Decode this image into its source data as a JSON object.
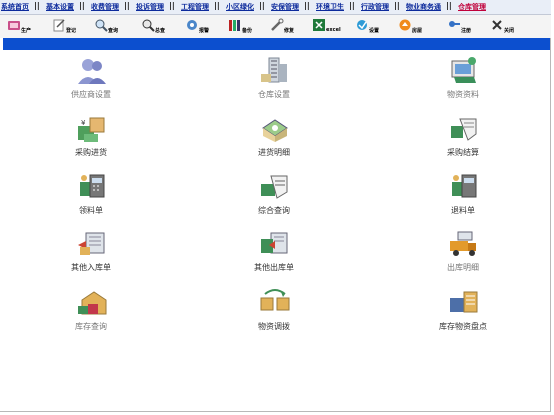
{
  "nav": [
    {
      "label": "系统首页",
      "active": false
    },
    {
      "label": "基本设置",
      "active": false
    },
    {
      "label": "收费管理",
      "active": false
    },
    {
      "label": "投诉管理",
      "active": false
    },
    {
      "label": "工程管理",
      "active": false
    },
    {
      "label": "小区绿化",
      "active": false
    },
    {
      "label": "安保管理",
      "active": false
    },
    {
      "label": "环境卫生",
      "active": false
    },
    {
      "label": "行政管理",
      "active": false
    },
    {
      "label": "物业商务通",
      "active": false
    },
    {
      "label": "仓库管理",
      "active": true
    }
  ],
  "toolbar": [
    {
      "label": "生产",
      "icon": "production-icon"
    },
    {
      "label": "登记",
      "icon": "register-icon"
    },
    {
      "label": "查询",
      "icon": "query-icon"
    },
    {
      "label": "总查",
      "icon": "global-search-icon"
    },
    {
      "label": "报警",
      "icon": "alarm-icon"
    },
    {
      "label": "备份",
      "icon": "backup-icon"
    },
    {
      "label": "修复",
      "icon": "repair-icon"
    },
    {
      "label": "excel",
      "icon": "excel-icon"
    },
    {
      "label": "设置",
      "icon": "settings-icon"
    },
    {
      "label": "房屋",
      "icon": "house-icon"
    },
    {
      "label": "注册",
      "icon": "register-key-icon"
    },
    {
      "label": "关闭",
      "icon": "close-icon"
    }
  ],
  "modules": [
    {
      "label": "供应商设置",
      "icon": "supplier-users-icon",
      "light": true
    },
    {
      "label": "仓库设置",
      "icon": "warehouse-building-icon",
      "light": true
    },
    {
      "label": "物资资料",
      "icon": "materials-folder-icon",
      "light": true
    },
    {
      "label": "采购进货",
      "icon": "purchase-goods-icon",
      "light": false
    },
    {
      "label": "进货明细",
      "icon": "purchase-detail-icon",
      "light": false
    },
    {
      "label": "采购结算",
      "icon": "purchase-settle-icon",
      "light": false
    },
    {
      "label": "领料单",
      "icon": "requisition-icon",
      "light": false
    },
    {
      "label": "综合查询",
      "icon": "combined-query-icon",
      "light": false
    },
    {
      "label": "退料单",
      "icon": "return-material-icon",
      "light": false
    },
    {
      "label": "其他入库单",
      "icon": "other-inbound-icon",
      "light": false
    },
    {
      "label": "其他出库单",
      "icon": "other-outbound-icon",
      "light": false
    },
    {
      "label": "出库明细",
      "icon": "outbound-detail-truck-icon",
      "light": true
    },
    {
      "label": "库存查询",
      "icon": "inventory-query-icon",
      "light": true
    },
    {
      "label": "物资调拨",
      "icon": "transfer-icon",
      "light": false
    },
    {
      "label": "库存物资盘点",
      "icon": "stocktake-icon",
      "light": false
    }
  ]
}
